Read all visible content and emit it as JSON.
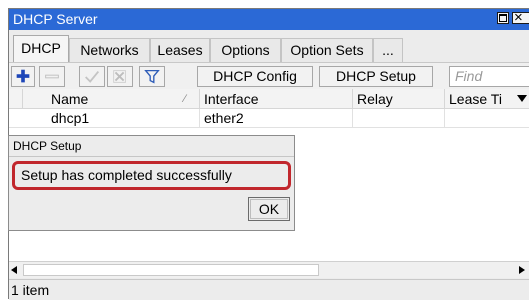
{
  "window": {
    "title": "DHCP Server"
  },
  "tabs": [
    {
      "label": "DHCP",
      "active": true
    },
    {
      "label": "Networks",
      "active": false
    },
    {
      "label": "Leases",
      "active": false
    },
    {
      "label": "Options",
      "active": false
    },
    {
      "label": "Option Sets",
      "active": false
    },
    {
      "label": "...",
      "active": false
    }
  ],
  "toolbar": {
    "add_icon": "plus-icon",
    "remove_icon": "minus-icon",
    "enable_icon": "check-icon",
    "disable_icon": "cross-icon",
    "filter_icon": "filter-icon",
    "dhcp_config_label": "DHCP Config",
    "dhcp_setup_label": "DHCP Setup",
    "find_placeholder": "Find"
  },
  "table": {
    "columns": [
      "Name",
      "Interface",
      "Relay",
      "Lease Ti"
    ],
    "rows": [
      {
        "name": "dhcp1",
        "interface": "ether2",
        "relay": "",
        "lease_time": ""
      }
    ]
  },
  "status": {
    "count_text": "1 item"
  },
  "dialog": {
    "title": "DHCP Setup",
    "message": "Setup has completed successfully",
    "ok_label": "OK"
  },
  "colors": {
    "titlebar": "#2b69d6",
    "add_icon": "#1d46b8",
    "highlight_border": "#c1272d"
  }
}
